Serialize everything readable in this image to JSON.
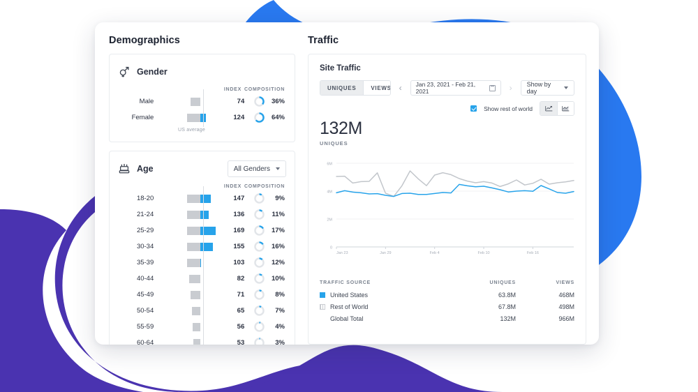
{
  "background": {
    "blue": "#2979f0",
    "purple": "#4a33b0"
  },
  "accent": "#27a3ea",
  "demographics": {
    "title": "Demographics",
    "gender": {
      "icon": "gender-icon",
      "title": "Gender",
      "headers": {
        "label": "",
        "index": "INDEX",
        "composition": "COMPOSITION"
      },
      "baseline_label": "US average",
      "rows": [
        {
          "label": "Male",
          "index": 74,
          "composition": "36%",
          "pct": 36
        },
        {
          "label": "Female",
          "index": 124,
          "composition": "64%",
          "pct": 64
        }
      ]
    },
    "age": {
      "icon": "cake-icon",
      "title": "Age",
      "filter": "All Genders",
      "headers": {
        "index": "INDEX",
        "composition": "COMPOSITION"
      },
      "rows": [
        {
          "label": "18-20",
          "index": 147,
          "composition": "9%",
          "pct": 9
        },
        {
          "label": "21-24",
          "index": 136,
          "composition": "11%",
          "pct": 11
        },
        {
          "label": "25-29",
          "index": 169,
          "composition": "17%",
          "pct": 17
        },
        {
          "label": "30-34",
          "index": 155,
          "composition": "16%",
          "pct": 16
        },
        {
          "label": "35-39",
          "index": 103,
          "composition": "12%",
          "pct": 12
        },
        {
          "label": "40-44",
          "index": 82,
          "composition": "10%",
          "pct": 10
        },
        {
          "label": "45-49",
          "index": 71,
          "composition": "8%",
          "pct": 8
        },
        {
          "label": "50-54",
          "index": 65,
          "composition": "7%",
          "pct": 7
        },
        {
          "label": "55-59",
          "index": 56,
          "composition": "4%",
          "pct": 4
        },
        {
          "label": "60-64",
          "index": 53,
          "composition": "3%",
          "pct": 3
        }
      ]
    }
  },
  "traffic": {
    "title": "Traffic",
    "site_title": "Site Traffic",
    "metric_tabs": [
      {
        "label": "UNIQUES",
        "active": true
      },
      {
        "label": "VIEWS",
        "active": false
      }
    ],
    "prev_arrow": "‹",
    "next_arrow": "›",
    "date_range": "Jan 23, 2021 - Feb 21, 2021",
    "granularity": "Show by day",
    "show_rest_of_world": {
      "label": "Show rest of world",
      "checked": true
    },
    "chart_type_buttons": [
      {
        "icon": "line-chart-icon",
        "active": true
      },
      {
        "icon": "area-chart-icon",
        "active": false
      }
    ],
    "total_value": "132M",
    "total_label": "UNIQUES",
    "table": {
      "headers": {
        "source": "TRAFFIC SOURCE",
        "uniques": "UNIQUES",
        "views": "VIEWS"
      },
      "rows": [
        {
          "source": "United States",
          "swatch": "solid",
          "uniques": "63.8M",
          "views": "468M"
        },
        {
          "source": "Rest of World",
          "swatch": "hatch",
          "uniques": "67.8M",
          "views": "498M"
        },
        {
          "source": "Global Total",
          "swatch": "none",
          "uniques": "132M",
          "views": "966M"
        }
      ]
    }
  },
  "chart_data": {
    "type": "line",
    "title": "Site Traffic",
    "xlabel": "",
    "ylabel": "",
    "ylim": [
      0,
      6000000
    ],
    "grid": true,
    "legend_position": "below-table",
    "y_ticks": [
      "0",
      "2M",
      "4M",
      "6M"
    ],
    "y_tick_values": [
      0,
      2000000,
      4000000,
      6000000
    ],
    "x_ticks": [
      "Jan 23",
      "Jan 29",
      "Feb 4",
      "Feb 10",
      "Feb 16"
    ],
    "x_tick_indices": [
      0,
      6,
      12,
      18,
      24
    ],
    "x": [
      "Jan 23",
      "Jan 24",
      "Jan 25",
      "Jan 26",
      "Jan 27",
      "Jan 28",
      "Jan 29",
      "Jan 30",
      "Jan 31",
      "Feb 1",
      "Feb 2",
      "Feb 3",
      "Feb 4",
      "Feb 5",
      "Feb 6",
      "Feb 7",
      "Feb 8",
      "Feb 9",
      "Feb 10",
      "Feb 11",
      "Feb 12",
      "Feb 13",
      "Feb 14",
      "Feb 15",
      "Feb 16",
      "Feb 17",
      "Feb 18",
      "Feb 19",
      "Feb 20",
      "Feb 21"
    ],
    "series": [
      {
        "name": "Rest of World",
        "color": "#c2c6cb",
        "values": [
          5050000,
          5070000,
          4580000,
          4680000,
          4700000,
          5310000,
          3850000,
          3620000,
          4380000,
          5450000,
          4880000,
          4390000,
          5150000,
          5320000,
          5180000,
          4900000,
          4720000,
          4600000,
          4680000,
          4580000,
          4330000,
          4520000,
          4800000,
          4440000,
          4560000,
          4850000,
          4500000,
          4600000,
          4660000,
          4760000
        ]
      },
      {
        "name": "United States",
        "color": "#27a3ea",
        "values": [
          3880000,
          4030000,
          3930000,
          3880000,
          3800000,
          3820000,
          3700000,
          3620000,
          3830000,
          3850000,
          3760000,
          3760000,
          3830000,
          3900000,
          3870000,
          4480000,
          4380000,
          4310000,
          4350000,
          4230000,
          4100000,
          3940000,
          4000000,
          4030000,
          3990000,
          4400000,
          4160000,
          3900000,
          3850000,
          3970000
        ]
      }
    ]
  }
}
